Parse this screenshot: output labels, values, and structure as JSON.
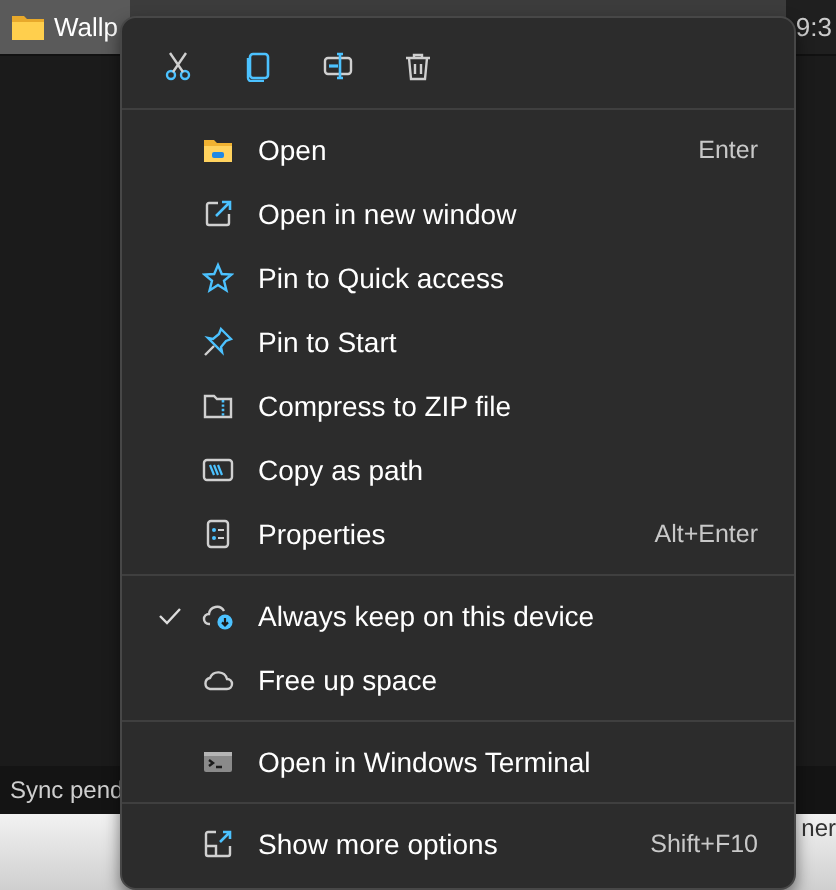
{
  "background": {
    "tab": {
      "label": "Wallp",
      "selected": true
    },
    "time": "9:3",
    "status": "Sync pend",
    "side_text": "ner"
  },
  "menu": {
    "toolbar": [
      {
        "kind": "cut"
      },
      {
        "kind": "copy"
      },
      {
        "kind": "rename"
      },
      {
        "kind": "delete"
      }
    ],
    "sections": [
      {
        "items": [
          {
            "kind": "open",
            "label": "Open",
            "shortcut": "Enter",
            "checked": false
          },
          {
            "kind": "new-window",
            "label": "Open in new window",
            "checked": false
          },
          {
            "kind": "star",
            "label": "Pin to Quick access",
            "checked": false
          },
          {
            "kind": "pin",
            "label": "Pin to Start",
            "checked": false
          },
          {
            "kind": "zip",
            "label": "Compress to ZIP file",
            "checked": false
          },
          {
            "kind": "path",
            "label": "Copy as path",
            "checked": false
          },
          {
            "kind": "properties",
            "label": "Properties",
            "shortcut": "Alt+Enter",
            "checked": false
          }
        ]
      },
      {
        "items": [
          {
            "kind": "cloud-keep",
            "label": "Always keep on this device",
            "checked": true
          },
          {
            "kind": "cloud",
            "label": "Free up space",
            "checked": false
          }
        ]
      },
      {
        "items": [
          {
            "kind": "terminal",
            "label": "Open in Windows Terminal",
            "checked": false
          }
        ]
      },
      {
        "items": [
          {
            "kind": "more",
            "label": "Show more options",
            "shortcut": "Shift+F10",
            "checked": false
          }
        ]
      }
    ]
  }
}
